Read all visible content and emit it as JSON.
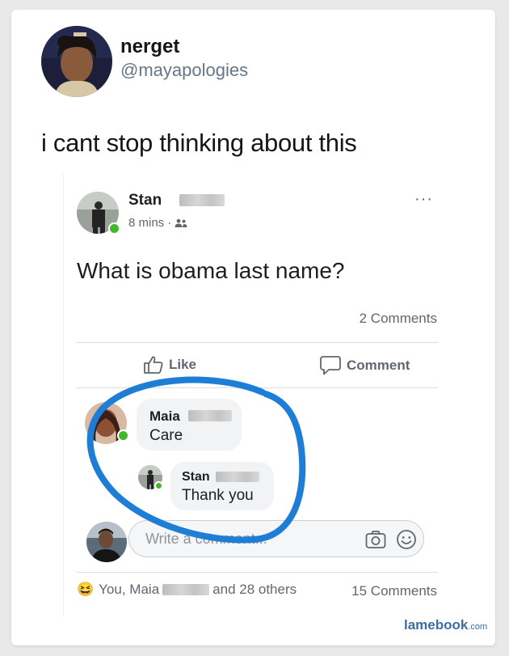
{
  "tweet": {
    "display_name": "nerget",
    "handle": "@mayapologies",
    "text": "i cant stop thinking about this"
  },
  "facebook_post": {
    "author_name": "Stan",
    "timestamp": "8 mins",
    "separator": "·",
    "audience_icon": "friends-icon",
    "more_icon": "more-options-icon",
    "more_label": "···",
    "question": "What is obama last name?",
    "comments_count": "2 Comments",
    "actions": {
      "like_label": "Like",
      "comment_label": "Comment"
    },
    "comments": [
      {
        "name": "Maia",
        "text": "Care"
      },
      {
        "name": "Stan",
        "text": "Thank you"
      }
    ],
    "write_comment_placeholder": "Write a comment...",
    "camera_icon": "camera-icon",
    "emoji_icon": "smiley-icon",
    "reactions": {
      "emoji": "😆",
      "text_before": "You, Maia",
      "text_after": "and 28 others"
    },
    "total_comments": "15 Comments"
  },
  "watermark": {
    "brand": "lamebook",
    "suffix": ".com"
  },
  "colors": {
    "annotation_circle": "#1e7ed6",
    "online_dot": "#42b72a",
    "twitter_handle": "#657786",
    "facebook_meta": "#606770"
  }
}
